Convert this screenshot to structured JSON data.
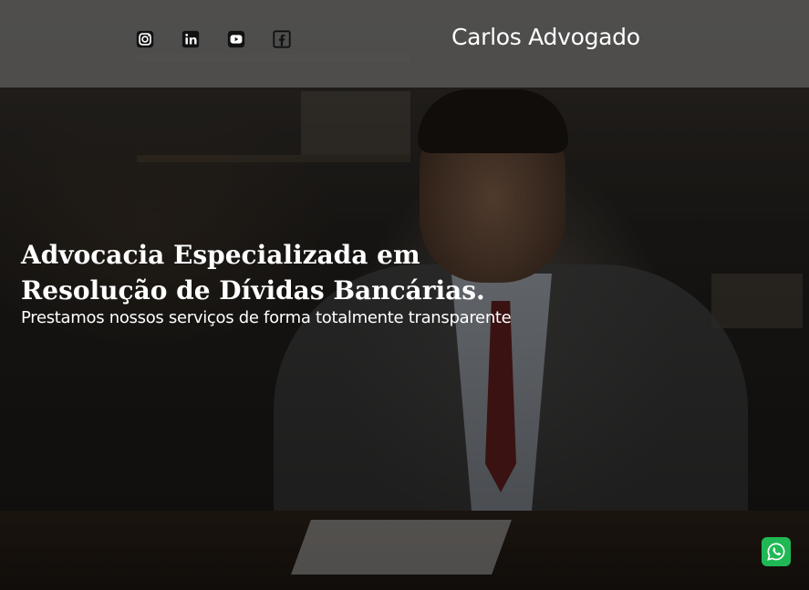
{
  "header": {
    "brand": "Carlos Advogado",
    "social": [
      {
        "icon": "instagram-icon"
      },
      {
        "icon": "linkedin-icon"
      },
      {
        "icon": "youtube-icon"
      },
      {
        "icon": "facebook-icon"
      }
    ]
  },
  "hero": {
    "title": "Advocacia Especializada em Resolução de Dívidas Bancárias.",
    "subtitle": "Prestamos nossos serviços de forma totalmente transparente"
  },
  "floating": {
    "whatsapp_icon": "whatsapp-icon"
  },
  "colors": {
    "header_bg": "#5f5f5f",
    "text": "#ffffff",
    "whatsapp": "#1fb855"
  }
}
